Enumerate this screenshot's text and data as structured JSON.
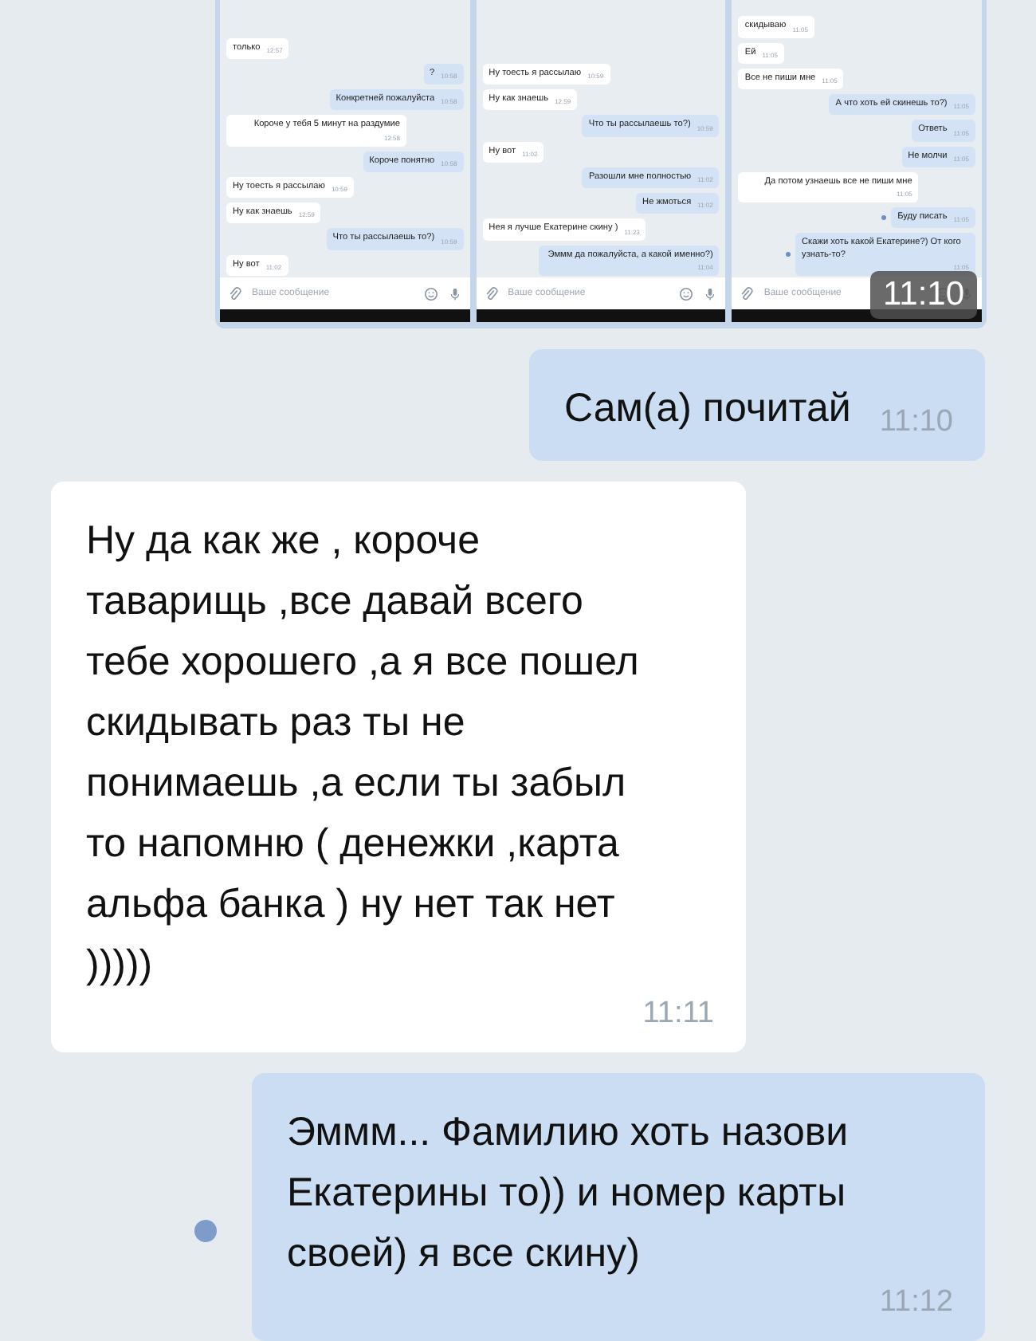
{
  "attachment": {
    "overlay_time": "11:10",
    "panels": [
      {
        "placeholder": "Ваше сообщение",
        "messages": [
          {
            "kind": "in",
            "text": "только",
            "time": "12:57",
            "unread": false
          },
          {
            "kind": "out",
            "text": "?",
            "time": "10:58",
            "unread": false
          },
          {
            "kind": "out",
            "text": "Конкретней пожалуйста",
            "time": "10:58",
            "unread": false
          },
          {
            "kind": "in",
            "text": "Короче у тебя 5 минут на раздумие",
            "time": "12:58",
            "unread": false
          },
          {
            "kind": "out",
            "text": "Короче понятно",
            "time": "10:58",
            "unread": false
          },
          {
            "kind": "in",
            "text": "Ну тоесть я рассылаю",
            "time": "10:59",
            "unread": false
          },
          {
            "kind": "in",
            "text": "Ну как знаешь",
            "time": "12:59",
            "unread": false
          },
          {
            "kind": "out",
            "text": "Что ты рассылаешь то?)",
            "time": "10:59",
            "unread": false
          },
          {
            "kind": "in",
            "text": "Ну вот",
            "time": "11:02",
            "unread": false
          }
        ]
      },
      {
        "placeholder": "Ваше сообщение",
        "messages": [
          {
            "kind": "in",
            "text": "Ну тоесть я рассылаю",
            "time": "10:59",
            "unread": false
          },
          {
            "kind": "in",
            "text": "Ну как знаешь",
            "time": "12:59",
            "unread": false
          },
          {
            "kind": "out",
            "text": "Что ты рассылаешь то?)",
            "time": "10:59",
            "unread": false
          },
          {
            "kind": "in",
            "text": "Ну вот",
            "time": "11:02",
            "unread": false
          },
          {
            "kind": "out",
            "text": "Разошли мне полностью",
            "time": "11:02",
            "unread": false
          },
          {
            "kind": "out",
            "text": "Не жмоться",
            "time": "11:02",
            "unread": false
          },
          {
            "kind": "in",
            "text": "Нея я лучше Екатерине скину )",
            "time": "11:23",
            "unread": false
          },
          {
            "kind": "out",
            "text": "Эммм да пожалуйста, а какой именно?)",
            "time": "11:04",
            "unread": false
          }
        ]
      },
      {
        "placeholder": "Ваше сообщение",
        "messages": [
          {
            "kind": "in",
            "text": "скидываю",
            "time": "11:05",
            "unread": false
          },
          {
            "kind": "in",
            "text": "Ей",
            "time": "11:05",
            "unread": false
          },
          {
            "kind": "in",
            "text": "Все не пиши мне",
            "time": "11:05",
            "unread": false
          },
          {
            "kind": "out",
            "text": "А что хоть ей скинешь то?)",
            "time": "11:05",
            "unread": false
          },
          {
            "kind": "out",
            "text": "Ответь",
            "time": "11:05",
            "unread": false
          },
          {
            "kind": "out",
            "text": "Не молчи",
            "time": "11:05",
            "unread": false
          },
          {
            "kind": "in",
            "text": "Да потом узнаешь все не пиши мне",
            "time": "11:05",
            "unread": false
          },
          {
            "kind": "out",
            "text": "Буду писать",
            "time": "11:05",
            "unread": true
          },
          {
            "kind": "out",
            "text": "Скажи хоть какой Екатерине?) От кого узнать-то?",
            "time": "11:05",
            "unread": true
          }
        ]
      }
    ]
  },
  "messages": [
    {
      "kind": "out",
      "text": "Сам(а) почитай",
      "time": "11:10",
      "unread": false
    },
    {
      "kind": "in",
      "text": "Ну да как же , короче таварищь ,все давай всего тебе хорошего ,а я все пошел скидывать раз ты не понимаешь ,а если ты забыл то напомню ( денежки ,карта альфа банка ) ну нет так нет )))))",
      "time": "11:11",
      "unread": false
    },
    {
      "kind": "out",
      "text": "Эммм... Фамилию хоть назови Екатерины то)) и номер карты своей) я все скину)",
      "time": "11:12",
      "unread": true
    }
  ]
}
